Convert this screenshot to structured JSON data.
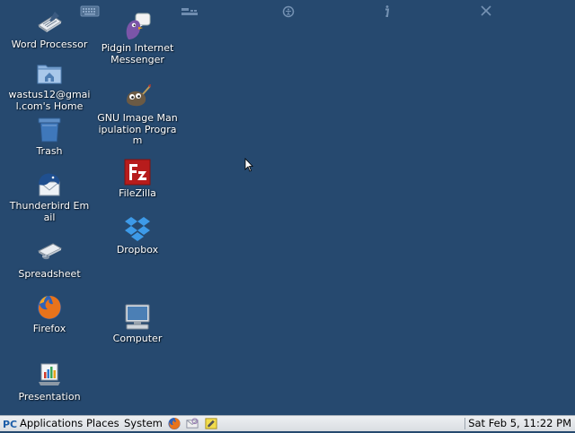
{
  "desktop": {
    "icons": [
      {
        "label": "Word Processor",
        "icon": "word-processor-icon"
      },
      {
        "label": "wastus12@gmail.com's Home",
        "icon": "home-folder-icon"
      },
      {
        "label": "Trash",
        "icon": "trash-icon"
      },
      {
        "label": "Thunderbird Email",
        "icon": "thunderbird-icon"
      },
      {
        "label": "Spreadsheet",
        "icon": "spreadsheet-icon"
      },
      {
        "label": "Firefox",
        "icon": "firefox-icon"
      },
      {
        "label": "Presentation",
        "icon": "presentation-icon"
      },
      {
        "label": "Pidgin Internet Messenger",
        "icon": "pidgin-icon"
      },
      {
        "label": "GNU Image Manipulation Program",
        "icon": "gimp-icon"
      },
      {
        "label": "FileZilla",
        "icon": "filezilla-icon"
      },
      {
        "label": "Dropbox",
        "icon": "dropbox-icon"
      },
      {
        "label": "Computer",
        "icon": "computer-icon"
      }
    ]
  },
  "topbar": {
    "buttons": [
      "keyboard-icon",
      "layout-icon",
      "accessibility-icon",
      "info-icon",
      "close-icon"
    ]
  },
  "panel": {
    "applications_label": "Applications",
    "places_label": "Places",
    "system_label": "System",
    "launchers": [
      "firefox-icon",
      "mail-icon",
      "notes-icon"
    ],
    "clock": "Sat Feb  5, 11:22 PM"
  },
  "colors": {
    "desktop_bg": "#26496f",
    "panel_bg": "#e4e7eb",
    "label_text": "#ffffff"
  }
}
